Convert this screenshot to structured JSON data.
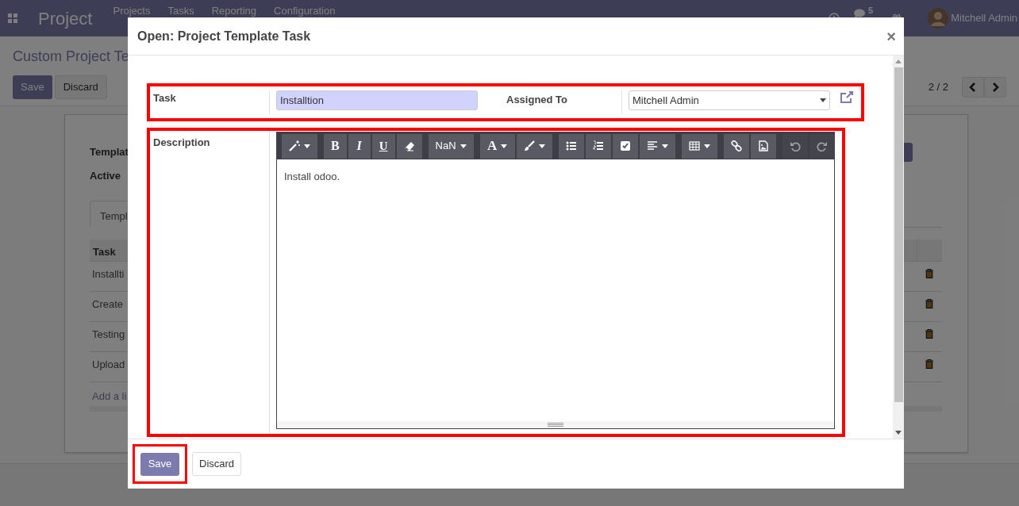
{
  "navbar": {
    "app_title": "Project",
    "menu": [
      "Projects",
      "Tasks",
      "Reporting",
      "Configuration"
    ],
    "message_count": "5",
    "user": "Mitchell Admin"
  },
  "control_panel": {
    "breadcrumb": "Custom Project Te",
    "buttons": [
      "Save",
      "Discard"
    ],
    "pager": "2 / 2"
  },
  "sheet": {
    "fields": [
      "Templat",
      "Active"
    ],
    "tab": "Templ",
    "table": {
      "columns": [
        "Task"
      ],
      "rows": [
        "Installti",
        "Create",
        "Testing",
        "Upload"
      ],
      "add_line": "Add a li"
    }
  },
  "dialog": {
    "title": "Open: Project Template Task",
    "close": "×",
    "task_label": "Task",
    "task_value": "Installtion",
    "assigned_label": "Assigned To",
    "assigned_value": "Mitchell Admin",
    "description_label": "Description",
    "toolbar": [
      [
        {
          "kind": "style",
          "disabled": false
        }
      ],
      [
        {
          "kind": "bold",
          "label": "B",
          "disabled": false
        },
        {
          "kind": "italic",
          "label": "I",
          "disabled": false
        },
        {
          "kind": "underline",
          "label": "U",
          "disabled": false
        },
        {
          "kind": "eraser",
          "disabled": false
        }
      ],
      [
        {
          "kind": "font-size",
          "label": "NaN",
          "disabled": false
        }
      ],
      [
        {
          "kind": "font-color",
          "label": "A",
          "disabled": false
        },
        {
          "kind": "brush",
          "disabled": false
        }
      ],
      [
        {
          "kind": "bullets",
          "disabled": false
        },
        {
          "kind": "numbers",
          "disabled": false
        },
        {
          "kind": "checklist",
          "disabled": false
        },
        {
          "kind": "align",
          "disabled": false
        }
      ],
      [
        {
          "kind": "table",
          "disabled": false
        }
      ],
      [
        {
          "kind": "link",
          "disabled": false
        },
        {
          "kind": "image",
          "disabled": false
        }
      ],
      [
        {
          "kind": "undo",
          "disabled": true
        },
        {
          "kind": "redo",
          "disabled": true
        }
      ]
    ],
    "description": "Install odoo.",
    "buttons": [
      {
        "label": "Save",
        "kind": "primary"
      },
      {
        "label": "Discard",
        "kind": "secondary"
      }
    ]
  }
}
